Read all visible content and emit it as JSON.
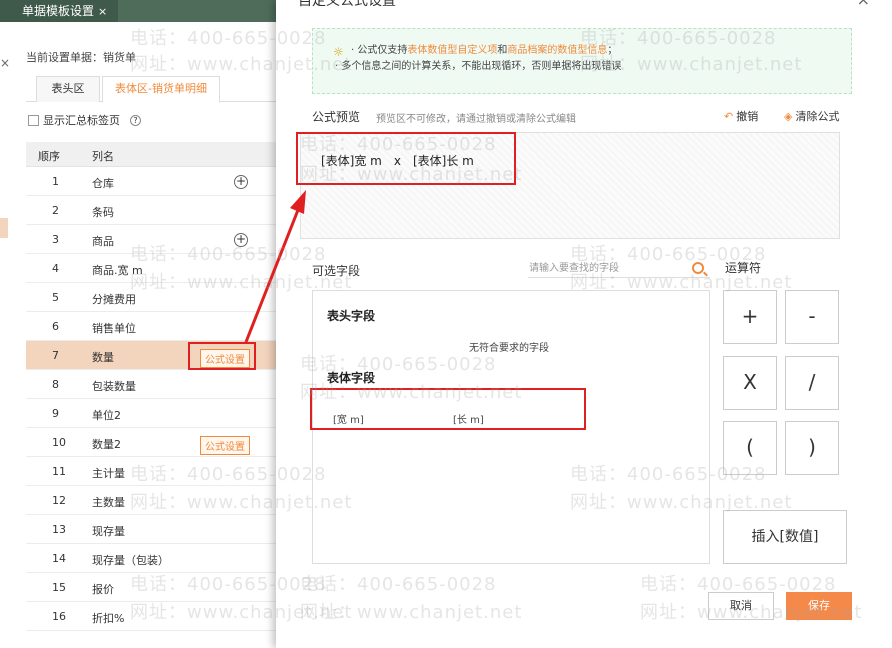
{
  "app": {
    "tab_title": "单据模板设置",
    "tab_close": "×",
    "current_doc": "当前设置单据：销货单",
    "side_close": "×"
  },
  "bg_tabs": [
    {
      "label": "表头区"
    },
    {
      "label": "表体区-销货单明细"
    }
  ],
  "show_tab_checkbox": "显示汇总标签页",
  "grid": {
    "headers": [
      "顺序",
      "列名"
    ],
    "rows": [
      {
        "no": "1",
        "name": "仓库"
      },
      {
        "no": "2",
        "name": "条码"
      },
      {
        "no": "3",
        "name": "商品"
      },
      {
        "no": "4",
        "name": "商品.宽 m"
      },
      {
        "no": "5",
        "name": "分摊费用"
      },
      {
        "no": "6",
        "name": "销售单位"
      },
      {
        "no": "7",
        "name": "数量"
      },
      {
        "no": "8",
        "name": "包装数量"
      },
      {
        "no": "9",
        "name": "单位2"
      },
      {
        "no": "10",
        "name": "数量2"
      },
      {
        "no": "11",
        "name": "主计量"
      },
      {
        "no": "12",
        "name": "主数量"
      },
      {
        "no": "13",
        "name": "现存量"
      },
      {
        "no": "14",
        "name": "现存量（包装）"
      },
      {
        "no": "15",
        "name": "报价"
      },
      {
        "no": "16",
        "name": "折扣%"
      }
    ],
    "formula_btn": "公式设置"
  },
  "dialog": {
    "title": "自定义公式设置",
    "close": "×",
    "tip": {
      "line1_a": "公式仅支持",
      "line1_b": "表体数值型自定义项",
      "line1_c": "和",
      "line1_d": "商品档案的数值型信息",
      "line1_e": "；",
      "line2": "· 多个信息之间的计算关系，不能出现循环，否则单据将出现错误"
    },
    "preview_label": "公式预览",
    "preview_hint": "预览区不可修改，请通过撤销或清除公式编辑",
    "undo": "撤销",
    "clear": "清除公式",
    "formula": {
      "a": "[表体]宽 m",
      "op": "x",
      "b": "[表体]长 m"
    },
    "fields_label": "可选字段",
    "search_placeholder": "请输入要查找的字段",
    "operators_label": "运算符",
    "header_fields": "表头字段",
    "no_match": "无符合要求的字段",
    "body_fields": "表体字段",
    "body_items": [
      "[宽 m]",
      "[长 m]"
    ],
    "ops": [
      "+",
      "-",
      "X",
      "/",
      "(",
      ")"
    ],
    "insert_value": "插入[数值]",
    "cancel": "取消",
    "save": "保存"
  },
  "watermark": {
    "phone": "电话：400-665-0028",
    "site": "网址：www.chanjet.net"
  },
  "colors": {
    "accent": "#f08a3c",
    "highlight": "#e02020",
    "save": "#f5894a"
  }
}
